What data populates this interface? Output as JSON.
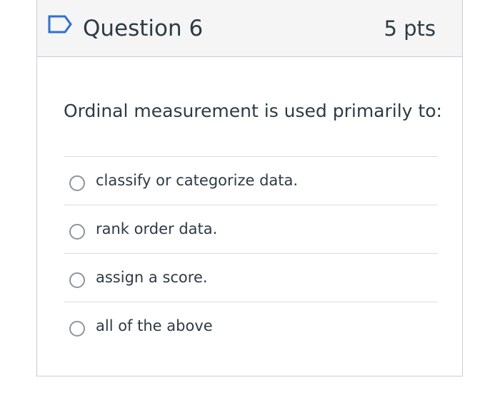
{
  "question": {
    "title": "Question 6",
    "points": "5 pts",
    "flag_icon": "flag-outline-icon",
    "text": "Ordinal measurement is used primarily to:",
    "answers": [
      {
        "label": "classify or categorize data."
      },
      {
        "label": "rank order data."
      },
      {
        "label": "assign a score."
      },
      {
        "label": "all of the above"
      }
    ]
  },
  "colors": {
    "accent": "#2d6fd8",
    "header_bg": "#f5f5f5",
    "border": "#c7cdd1",
    "text": "#2d3b45"
  }
}
